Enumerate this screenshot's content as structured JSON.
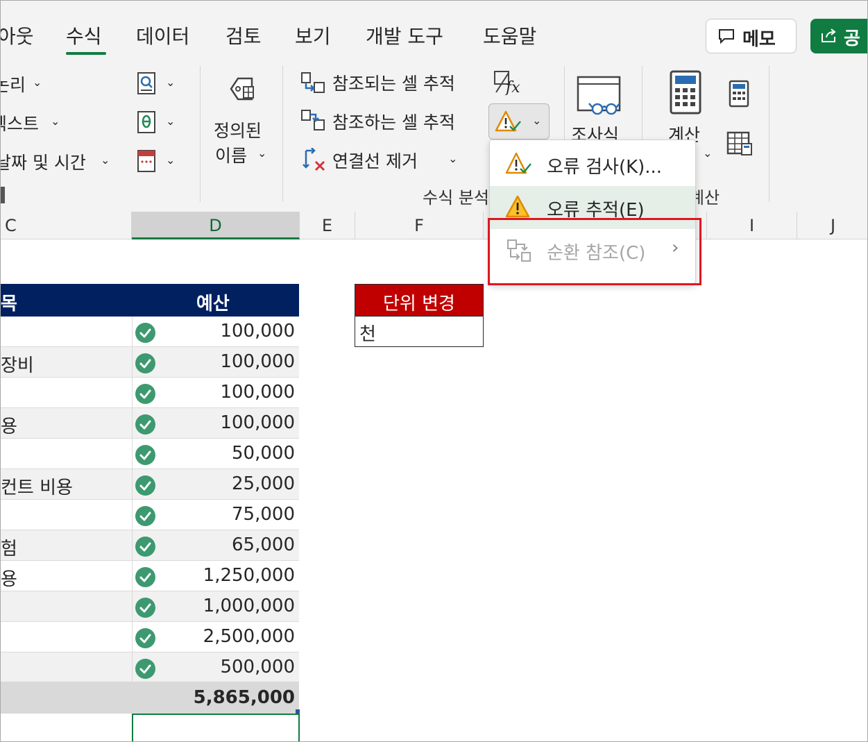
{
  "tabs": {
    "layout": "아웃",
    "formulas": "수식",
    "data": "데이터",
    "review": "검토",
    "view": "보기",
    "developer": "개발 도구",
    "help": "도움말"
  },
  "header": {
    "memo_label": "메모",
    "share_label": "공"
  },
  "ribbon": {
    "logical": "논리",
    "text": "텍스트",
    "datetime": "날짜 및 시간",
    "defined_names": [
      "정의된",
      "이름"
    ],
    "trace_precedents": "참조되는 셀 추적",
    "trace_dependents": "참조하는 셀 추적",
    "remove_arrows": "연결선 제거",
    "watch_window": "조사식",
    "calculation": "계산",
    "group_formula_auditing": "수식 분석",
    "group_calculation": "계산"
  },
  "dropdown": {
    "items": [
      {
        "label": "오류 검사(K)...",
        "icon": "error-check-icon",
        "state": "normal"
      },
      {
        "label": "오류 추적(E)",
        "icon": "warning-icon",
        "state": "hover"
      },
      {
        "label": "순환 참조(C)",
        "icon": "circular-reference-icon",
        "state": "disabled",
        "has_submenu": true
      }
    ]
  },
  "columns": [
    "C",
    "D",
    "E",
    "F",
    "I",
    "J"
  ],
  "table": {
    "col_c_header": "목",
    "col_d_header": "예산",
    "rows": [
      {
        "name": "",
        "value": "100,000"
      },
      {
        "name": "장비",
        "value": "100,000"
      },
      {
        "name": "",
        "value": "100,000"
      },
      {
        "name": "용",
        "value": "100,000"
      },
      {
        "name": "",
        "value": "50,000"
      },
      {
        "name": "컨트 비용",
        "value": "25,000"
      },
      {
        "name": "",
        "value": "75,000"
      },
      {
        "name": "험",
        "value": "65,000"
      },
      {
        "name": "용",
        "value": "1,250,000"
      },
      {
        "name": "",
        "value": "1,000,000"
      },
      {
        "name": "",
        "value": "2,500,000"
      },
      {
        "name": "",
        "value": "500,000"
      }
    ],
    "total": "5,865,000"
  },
  "unit_box": {
    "header": "단위 변경",
    "value": "천"
  },
  "colors": {
    "accent": "#107c41",
    "table_header": "#002060",
    "unit_header": "#c00000",
    "highlight": "#e0161f",
    "check": "#3d9970"
  }
}
